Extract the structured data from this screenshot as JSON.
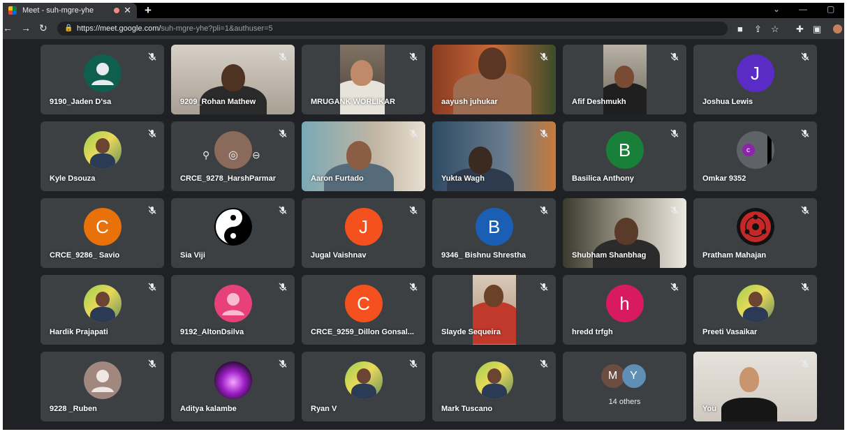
{
  "browser": {
    "tab_title": "Meet - suh-mgre-yhe",
    "url_host": "https://meet.google.com/",
    "url_path": "suh-mgre-yhe?pli=1&authuser=5"
  },
  "colors": {
    "meet_bg": "#202124",
    "tile_bg": "#3c4043"
  },
  "participants": [
    {
      "name": "9190_Jaden D'sa",
      "type": "person-avatar"
    },
    {
      "name": "9209_Rohan Mathew",
      "type": "video"
    },
    {
      "name": "MRUGANK WORLIKAR",
      "type": "video"
    },
    {
      "name": "aayush juhukar",
      "type": "video"
    },
    {
      "name": "Afif Deshmukh",
      "type": "video"
    },
    {
      "name": "Joshua Lewis",
      "type": "initial",
      "initial": "J",
      "color": "#5b2bc6"
    },
    {
      "name": "Kyle Dsouza",
      "type": "photo-avatar"
    },
    {
      "name": "CRCE_9278_HarshParmar",
      "type": "hover-controls"
    },
    {
      "name": "Aaron Furtado",
      "type": "video"
    },
    {
      "name": "Yukta Wagh",
      "type": "video"
    },
    {
      "name": "Basilica Anthony",
      "type": "initial",
      "initial": "B",
      "color": "#188038"
    },
    {
      "name": "Omkar 9352",
      "type": "small-avatar",
      "initial": "c"
    },
    {
      "name": "CRCE_9286_ Savio",
      "type": "initial",
      "initial": "C",
      "color": "#e8710a"
    },
    {
      "name": "Sia Viji",
      "type": "yin-yang"
    },
    {
      "name": "Jugal Vaishnav",
      "type": "initial",
      "initial": "J",
      "color": "#f4511e"
    },
    {
      "name": "9346_ Bishnu Shrestha",
      "type": "initial",
      "initial": "B",
      "color": "#1a5fb4"
    },
    {
      "name": "Shubham Shanbhag",
      "type": "video"
    },
    {
      "name": "Pratham Mahajan",
      "type": "sharingan"
    },
    {
      "name": "Hardik Prajapati",
      "type": "photo-avatar"
    },
    {
      "name": "9192_AltonDsilva",
      "type": "person-avatar-pink"
    },
    {
      "name": "CRCE_9259_Dillon Gonsal...",
      "type": "initial",
      "initial": "C",
      "color": "#f4511e"
    },
    {
      "name": "Slayde Sequeira",
      "type": "video"
    },
    {
      "name": "hredd trfgh",
      "type": "initial",
      "initial": "h",
      "color": "#d81b60"
    },
    {
      "name": "Preeti Vasaikar",
      "type": "photo-avatar"
    },
    {
      "name": "9228 _Ruben",
      "type": "person-avatar-brown"
    },
    {
      "name": "Aditya kalambe",
      "type": "photo-avatar-purple"
    },
    {
      "name": "Ryan V",
      "type": "photo-avatar"
    },
    {
      "name": "Mark Tuscano",
      "type": "photo-avatar"
    },
    {
      "name": "14 others",
      "type": "others",
      "initials": [
        "M",
        "Y"
      ]
    },
    {
      "name": "You",
      "type": "self-video"
    }
  ]
}
